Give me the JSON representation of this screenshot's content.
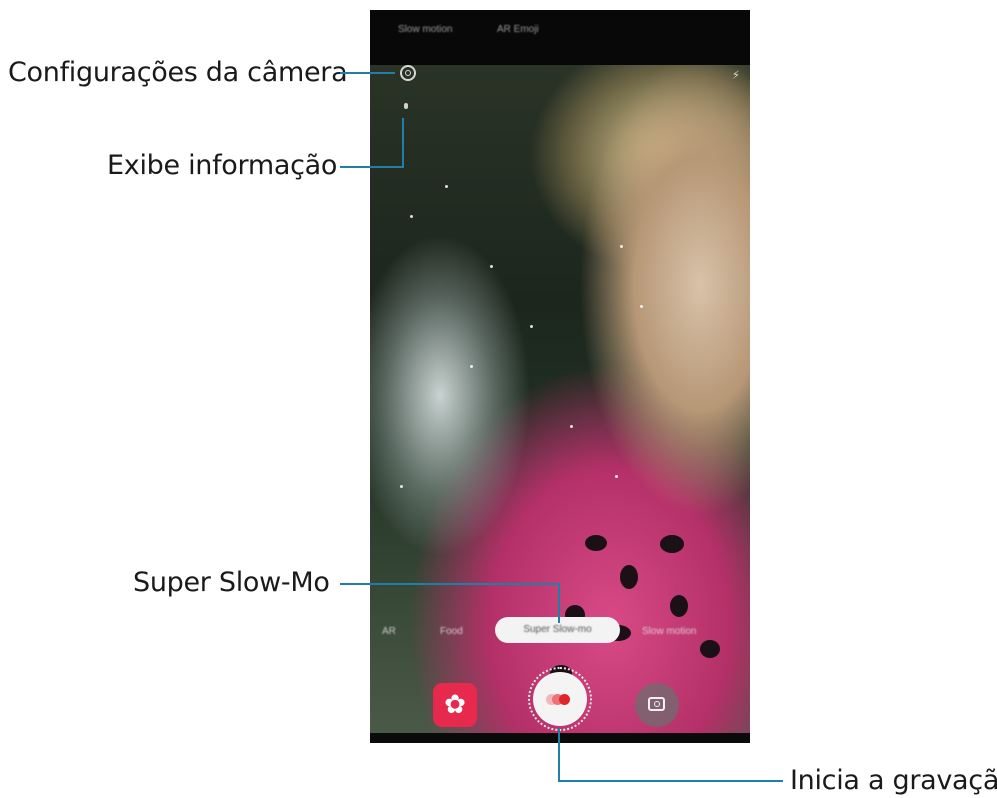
{
  "callouts": {
    "camera_settings": "Configurações da câmera",
    "show_info": "Exibe informação",
    "super_slow_mo": "Super Slow-Mo",
    "start_recording": "Inicia a gravação"
  },
  "screen": {
    "top_tabs": [
      "Slow motion",
      "AR Emoji"
    ],
    "flash_glyph": "⚡",
    "modes": [
      "AR",
      "Food",
      "Super Slow-mo",
      "Slow motion"
    ],
    "selected_mode": "Super Slow-mo",
    "gallery_glyph": "✿"
  },
  "colors": {
    "callout_line": "#1f7fa8",
    "gallery_button": "#e6294d",
    "record_dot": "#e0262b"
  },
  "icons": {
    "camera_settings": "gear-icon",
    "show_info": "info-icon",
    "flash": "flash-icon",
    "gallery": "gallery-thumbnail-icon",
    "record": "record-icon",
    "switch_camera": "switch-camera-icon"
  }
}
